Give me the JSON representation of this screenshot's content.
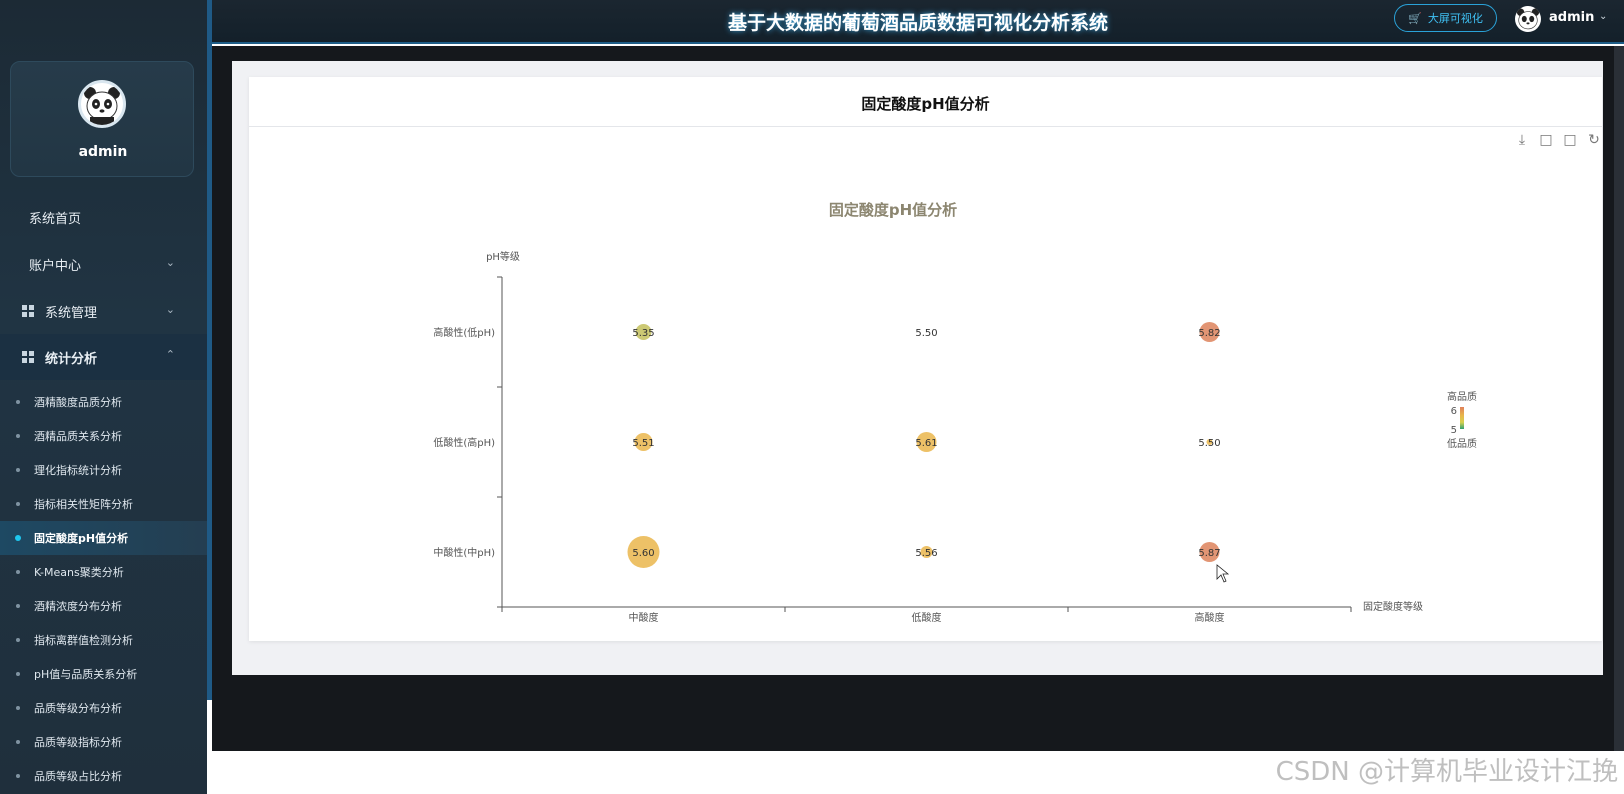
{
  "header": {
    "title": "基于大数据的葡萄酒品质数据可视化分析系统",
    "bigscreen_label": "大屏可视化",
    "user": "admin"
  },
  "sidebar": {
    "profile_name": "admin",
    "menu": [
      {
        "label": "系统首页"
      },
      {
        "label": "账户中心"
      },
      {
        "label": "系统管理"
      },
      {
        "label": "统计分析"
      }
    ],
    "sub_items": [
      {
        "label": "酒精酸度品质分析"
      },
      {
        "label": "酒精品质关系分析"
      },
      {
        "label": "理化指标统计分析"
      },
      {
        "label": "指标相关性矩阵分析"
      },
      {
        "label": "固定酸度pH值分析"
      },
      {
        "label": "K-Means聚类分析"
      },
      {
        "label": "酒精浓度分布分析"
      },
      {
        "label": "指标离群值检测分析"
      },
      {
        "label": "pH值与品质关系分析"
      },
      {
        "label": "品质等级分布分析"
      },
      {
        "label": "品质等级指标分析"
      },
      {
        "label": "品质等级占比分析"
      }
    ],
    "active_index": 4
  },
  "card": {
    "title": "固定酸度pH值分析"
  },
  "chart_data": {
    "type": "scatter",
    "title": "固定酸度pH值分析",
    "xlabel": "固定酸度等级",
    "ylabel": "pH等级",
    "x_categories": [
      "中酸度",
      "低酸度",
      "高酸度"
    ],
    "y_categories": [
      "中酸性(中pH)",
      "低酸性(高pH)",
      "高酸性(低pH)"
    ],
    "points": [
      {
        "x": "中酸度",
        "y": "高酸性(低pH)",
        "value": 5.35,
        "label": "5.35",
        "size": 8
      },
      {
        "x": "低酸度",
        "y": "高酸性(低pH)",
        "value": 5.5,
        "label": "5.50",
        "size": 0
      },
      {
        "x": "高酸度",
        "y": "高酸性(低pH)",
        "value": 5.82,
        "label": "5.82",
        "size": 10
      },
      {
        "x": "中酸度",
        "y": "低酸性(高pH)",
        "value": 5.51,
        "label": "5.51",
        "size": 9
      },
      {
        "x": "低酸度",
        "y": "低酸性(高pH)",
        "value": 5.61,
        "label": "5.61",
        "size": 10
      },
      {
        "x": "高酸度",
        "y": "低酸性(高pH)",
        "value": 5.5,
        "label": "5.50",
        "size": 3
      },
      {
        "x": "中酸度",
        "y": "中酸性(中pH)",
        "value": 5.6,
        "label": "5.60",
        "size": 16
      },
      {
        "x": "低酸度",
        "y": "中酸性(中pH)",
        "value": 5.56,
        "label": "5.56",
        "size": 6
      },
      {
        "x": "高酸度",
        "y": "中酸性(中pH)",
        "value": 5.87,
        "label": "5.87",
        "size": 10
      }
    ],
    "visual_map": {
      "high_label": "高品质",
      "low_label": "低品质",
      "max": "6",
      "min": "5",
      "colors": [
        "#d4d050",
        "#e8b84a",
        "#e0805a",
        "#2e9e72"
      ]
    },
    "grid": false
  },
  "watermark": "CSDN @计算机毕业设计江挽",
  "toolbox_icons": [
    "download-icon",
    "zoom-icon",
    "zoom-reset-icon",
    "refresh-icon"
  ]
}
